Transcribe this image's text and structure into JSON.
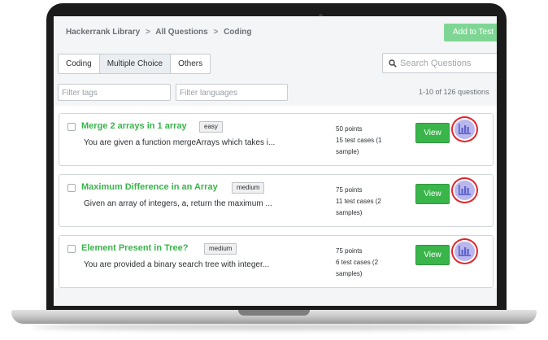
{
  "breadcrumb": {
    "library": "Hackerrank Library",
    "sep1": ">",
    "all": "All Questions",
    "sep2": ">",
    "current": "Coding"
  },
  "add_to_test": "Add to Test",
  "tabs": [
    {
      "label": "Coding"
    },
    {
      "label": "Multiple Choice"
    },
    {
      "label": "Others"
    }
  ],
  "search": {
    "placeholder": "Search Questions",
    "icon": "search-icon"
  },
  "filters": {
    "tags_placeholder": "Filter tags",
    "languages_placeholder": "Filter languages"
  },
  "results_count": "1-10 of 126 questions",
  "questions": [
    {
      "title": "Merge 2 arrays in 1 array",
      "difficulty": "easy",
      "description": "You are given a function mergeArrays which takes i...",
      "points": "50 points",
      "test_cases": "15 test cases (1 sample)",
      "view_label": "View",
      "stats_icon": "bar-chart-icon"
    },
    {
      "title": "Maximum Difference in an Array",
      "difficulty": "medium",
      "description": "Given an array of integers, a, return the maximum ...",
      "points": "75 points",
      "test_cases": "11 test cases (2 samples)",
      "view_label": "View",
      "stats_icon": "bar-chart-icon"
    },
    {
      "title": "Element Present in Tree?",
      "difficulty": "medium",
      "description": "You are provided a binary search tree with integer...",
      "points": "75 points",
      "test_cases": "6 test cases (2 samples)",
      "view_label": "View",
      "stats_icon": "bar-chart-icon"
    }
  ],
  "colors": {
    "accent_green": "#39b54a",
    "highlight_red": "#e0262c",
    "stats_purple": "#b9b7ec"
  }
}
